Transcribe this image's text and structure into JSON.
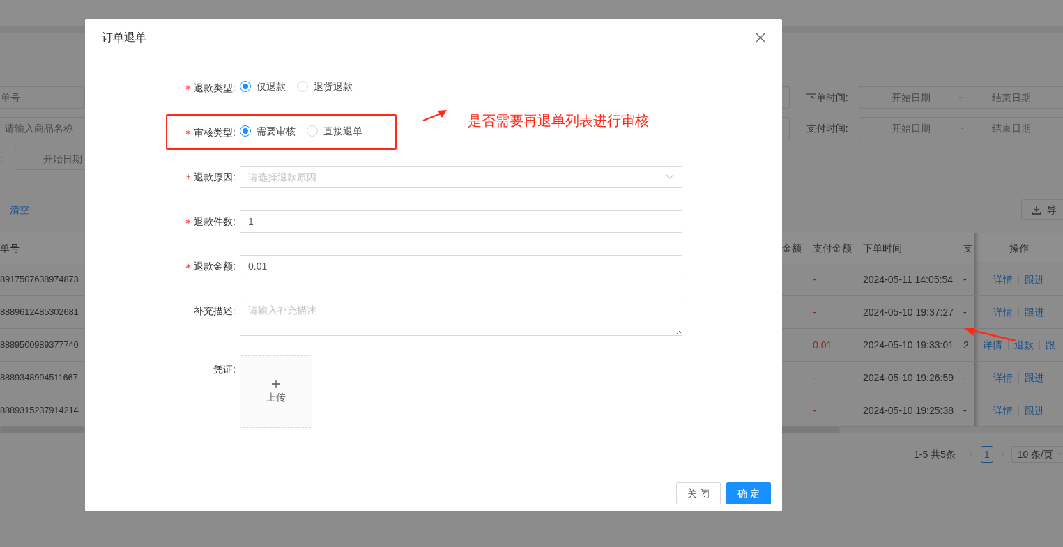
{
  "background_page": {
    "filters_left": [
      {
        "placeholder": "单号"
      },
      {
        "placeholder": "请输入商品名称"
      },
      {
        "label": ":",
        "placeholder": "开始日期"
      }
    ],
    "filters_right": [
      {
        "label": "下单时间:",
        "start_placeholder": "开始日期",
        "separator": "~",
        "end_placeholder": "结束日期"
      },
      {
        "label": "支付时间:",
        "start_placeholder": "开始日期",
        "separator": "~",
        "end_placeholder": "结束日期"
      }
    ],
    "clear_link": "清空",
    "export_button": "导",
    "table": {
      "columns_left": [
        "单号"
      ],
      "columns_right": [
        "金额",
        "支付金额",
        "下单时间",
        "支",
        "操作"
      ],
      "rows": [
        {
          "order_no": "8917507638974873",
          "paid_amount": "-",
          "order_time": "2024-05-11 14:05:54",
          "column_4": "-",
          "actions": [
            "详情",
            "跟进"
          ]
        },
        {
          "order_no": "8889612485302681",
          "paid_amount": "-",
          "order_time": "2024-05-10 19:37:27",
          "column_4": "-",
          "actions": [
            "详情",
            "跟进"
          ]
        },
        {
          "order_no": "8889500989377740",
          "paid_amount": "0.01",
          "order_time": "2024-05-10 19:33:01",
          "column_4": "2",
          "actions": [
            "详情",
            "退款",
            "跟"
          ]
        },
        {
          "order_no": "8889348994511667",
          "paid_amount": "-",
          "order_time": "2024-05-10 19:26:59",
          "column_4": "-",
          "actions": [
            "详情",
            "跟进"
          ]
        },
        {
          "order_no": "8889315237914214",
          "paid_amount": "-",
          "order_time": "2024-05-10 19:25:38",
          "column_4": "-",
          "actions": [
            "详情",
            "跟进"
          ]
        }
      ]
    },
    "pagination": {
      "summary": "1-5 共5条",
      "pages": [
        {
          "label": "1",
          "selected": true
        }
      ],
      "page_size": "10 条/页"
    }
  },
  "dialog": {
    "title": "订单退单",
    "form": [
      {
        "kind": "radio",
        "label": "退款类型:",
        "required": true,
        "options": [
          {
            "label": "仅退款",
            "selected": true
          },
          {
            "label": "退货退款",
            "selected": false
          }
        ]
      },
      {
        "kind": "radio",
        "label": "审核类型:",
        "required": true,
        "options": [
          {
            "label": "需要审核",
            "selected": true
          },
          {
            "label": "直接退单",
            "selected": false
          }
        ]
      },
      {
        "kind": "select",
        "label": "退款原因:",
        "required": true,
        "placeholder": "请选择退款原因"
      },
      {
        "kind": "input",
        "label": "退款件数:",
        "required": true,
        "value": "1"
      },
      {
        "kind": "input",
        "label": "退款金额:",
        "required": true,
        "value": "0.01"
      },
      {
        "kind": "textarea",
        "label": "补充描述:",
        "required": false,
        "placeholder": "请输入补充描述"
      },
      {
        "kind": "upload",
        "label": "凭证:",
        "required": false,
        "button": "上传"
      }
    ],
    "buttons": [
      {
        "label": "关 闭",
        "kind": "default"
      },
      {
        "label": "确 定",
        "kind": "primary"
      }
    ]
  },
  "annotation": {
    "note": "是否需要再退单列表进行审核"
  }
}
